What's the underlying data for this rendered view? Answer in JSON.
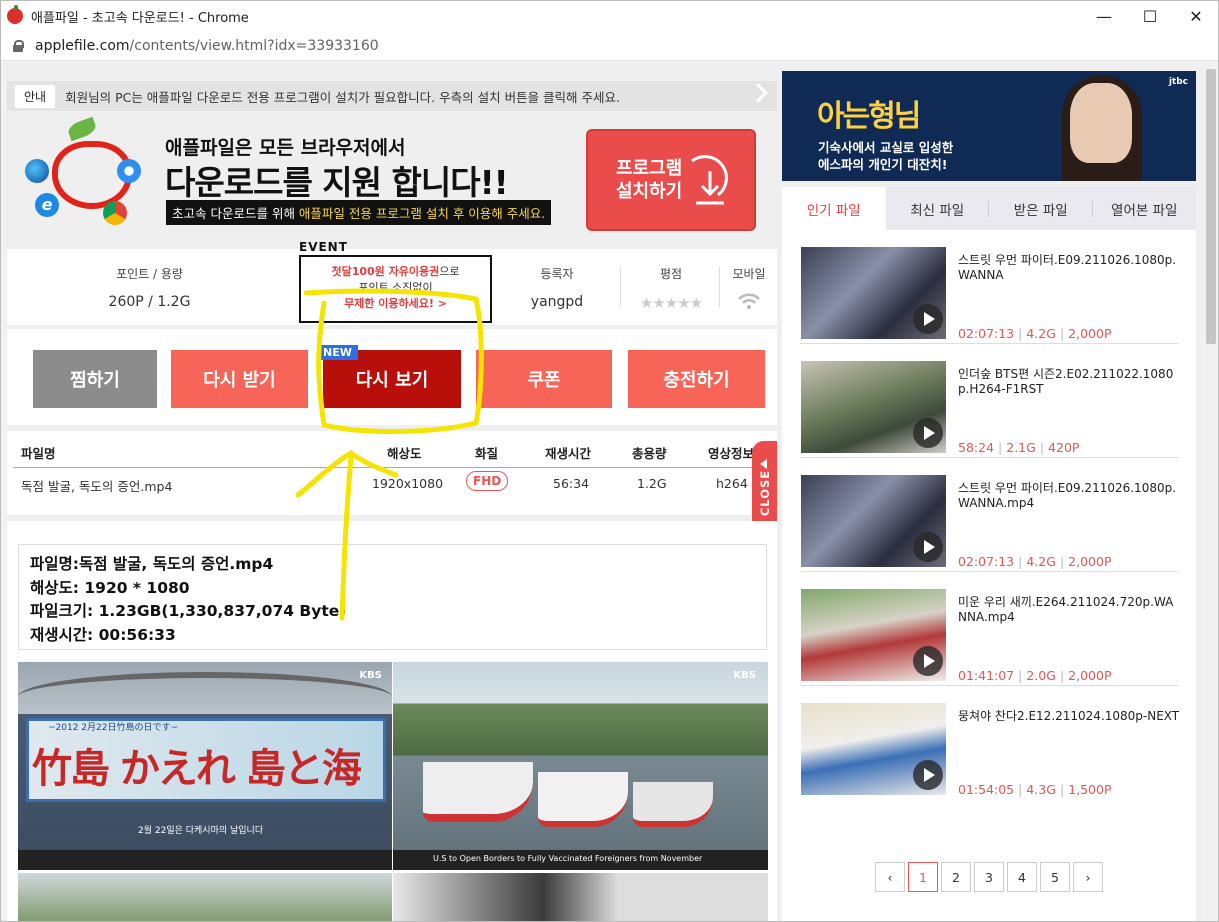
{
  "window": {
    "title": "애플파일 - 초고속 다운로드! - Chrome",
    "controls": {
      "minimize": "—",
      "maximize": "☐",
      "close": "✕"
    }
  },
  "address": {
    "domain": "applefile.com",
    "path": "/contents/view.html?idx=33933160"
  },
  "notice": {
    "tag": "안내",
    "text": "회원님의 PC는 애플파일 다운로드 전용 프로그램이 설치가 필요합니다. 우측의 설치 버튼을 클릭해 주세요."
  },
  "banner": {
    "line1": "애플파일은 모든 브라우저에서",
    "line2": "다운로드를 지원 합니다!!",
    "line3_pre": "초고속 다운로드를 위해 ",
    "line3_hl": "애플파일 전용 프로그램 설치 후 이용해 주세요.",
    "install_label_1": "프로그램",
    "install_label_2": "설치하기"
  },
  "info": {
    "points_label": "포인트 / 용량",
    "points_value": "260P / 1.2G",
    "uploader_label": "등록자",
    "uploader_value": "yangpd",
    "rating_label": "평점",
    "rating_stars": "★★★★★",
    "mobile_label": "모바일"
  },
  "event": {
    "tag": "EVENT",
    "line1_hl": "첫달100원 자유이용권",
    "line1_rest": "으로",
    "line2": "포인트 소진없이",
    "line3": "무제한 이용하세요! >"
  },
  "actions": {
    "zzim": "찜하기",
    "redownload": "다시 받기",
    "rewatch": "다시 보기",
    "coupon": "쿠폰",
    "charge": "충전하기",
    "new_tag": "NEW"
  },
  "table": {
    "headers": [
      "파일명",
      "해상도",
      "화질",
      "재생시간",
      "총용량",
      "영상정보"
    ],
    "row": {
      "name": "독점 발굴, 독도의 증언.mp4",
      "resolution": "1920x1080",
      "quality": "FHD",
      "duration": "56:34",
      "size": "1.2G",
      "codec": "h264"
    }
  },
  "close_label": "CLOSE",
  "details": {
    "l1": "파일명:독점 발굴, 독도의 증언.mp4",
    "l2": "해상도: 1920 * 1080",
    "l3": "파일크기: 1.23GB(1,330,837,074 Byte)",
    "l4": "재생시간: 00:56:33"
  },
  "screens": {
    "s1_sign": "竹島 かえれ 島と海",
    "s1_sub": "~2012 2月22日竹島の日です~",
    "s1_cap": "2월 22일은 다케시마의 날입니다",
    "s1_channel": "KBS",
    "s2_channel": "KBS",
    "s2_caption": "U.S to Open Borders to Fully Vaccinated Foreigners from November"
  },
  "ad": {
    "title": "아는형님",
    "line1": "기숙사에서 교실로 입성한",
    "line2": "에스파의 개인기 대잔치!",
    "channel": "jtbc"
  },
  "tabs": [
    "인기 파일",
    "최신 파일",
    "받은 파일",
    "열어본 파일"
  ],
  "list": [
    {
      "title": "스트릿 우먼 파이터.E09.211026.1080p.WANNA",
      "duration": "02:07:13",
      "size": "4.2G",
      "price": "2,000P"
    },
    {
      "title": "인더숲 BTS편 시즌2.E02.211022.1080p.H264-F1RST",
      "duration": "58:24",
      "size": "2.1G",
      "price": "420P"
    },
    {
      "title": "스트릿 우먼 파이터.E09.211026.1080p.WANNA.mp4",
      "duration": "02:07:13",
      "size": "4.2G",
      "price": "2,000P"
    },
    {
      "title": "미운 우리 새끼.E264.211024.720p.WANNA.mp4",
      "duration": "01:41:07",
      "size": "2.0G",
      "price": "2,000P"
    },
    {
      "title": "뭉쳐야 찬다2.E12.211024.1080p-NEXT",
      "duration": "01:54:05",
      "size": "4.3G",
      "price": "1,500P"
    }
  ],
  "pager": {
    "prev": "‹",
    "pages": [
      "1",
      "2",
      "3",
      "4",
      "5"
    ],
    "current": "1",
    "next": "›"
  },
  "colors": {
    "accent": "#ea4b4b",
    "dark_red": "#b80f0a",
    "gray_button": "#8c8c8c",
    "price": "#e25757"
  }
}
